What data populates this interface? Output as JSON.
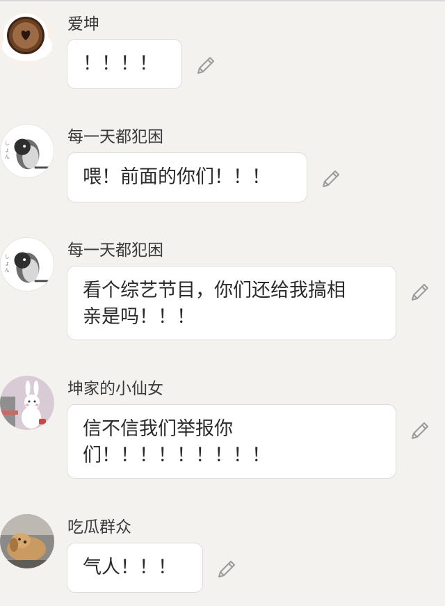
{
  "colors": {
    "background": "#f3f2ee",
    "bubble": "#ffffff",
    "bubble_border": "#dcdcdc",
    "text": "#2a2a2a",
    "icon": "#9a9a9a"
  },
  "messages": [
    {
      "sender": "爱坤",
      "avatar_icon": "coffee-avatar",
      "lines": [
        "！！！！"
      ],
      "edit_icon": "pencil-icon"
    },
    {
      "sender": "每一天都犯困",
      "avatar_icon": "penguin-avatar",
      "lines": [
        "喂！前面的你们！！！"
      ],
      "edit_icon": "pencil-icon"
    },
    {
      "sender": "每一天都犯困",
      "avatar_icon": "penguin-avatar",
      "lines": [
        "看个综艺节目，你们还给我搞相",
        "亲是吗！！！"
      ],
      "edit_icon": "pencil-icon"
    },
    {
      "sender": "坤家的小仙女",
      "avatar_icon": "bunny-avatar",
      "lines": [
        "信不信我们举报你",
        "们！！！！！！！！！"
      ],
      "edit_icon": "pencil-icon"
    },
    {
      "sender": "吃瓜群众",
      "avatar_icon": "dog-avatar",
      "lines": [
        "气人！！！"
      ],
      "edit_icon": "pencil-icon"
    }
  ]
}
